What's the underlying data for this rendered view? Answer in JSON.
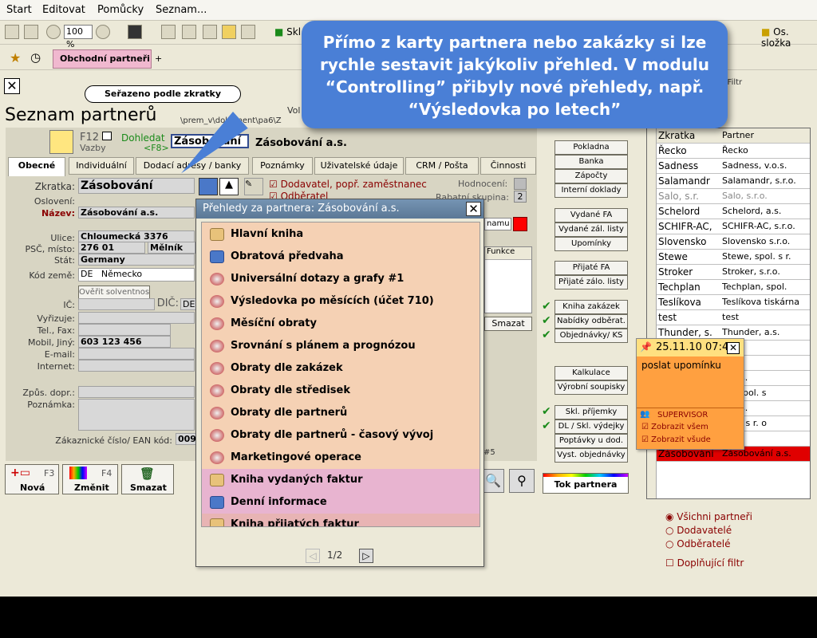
{
  "menu": [
    "Start",
    "Editovat",
    "Pomůcky",
    "Seznam..."
  ],
  "toolbar": {
    "zoom": "100 %",
    "skl": "Skl",
    "os_slozka": "Os. složka"
  },
  "tabbar": {
    "active_tab": "Obchodní partneři",
    "add": "+"
  },
  "sort_bubble": "Seřazeno podle zkratky",
  "page_title": "Seznam partnerů",
  "path": "\\prem_v\\dokument\\pa6\\Z",
  "vol": "Vol",
  "filtr": "/ Filtr",
  "f12": {
    "key": "F12",
    "label": "Vazby"
  },
  "dohledat": {
    "label": "Dohledat",
    "key": "<F8>",
    "value": "Zásobování",
    "result": "Zásobování a.s."
  },
  "tabs": [
    "Obecné",
    "Individuální",
    "Dodací adresy / banky",
    "Poznámky",
    "Uživatelské údaje",
    "CRM / Pošta",
    "Činnosti"
  ],
  "form": {
    "zkratka_label": "Zkratka:",
    "zkratka": "Zásobování",
    "osloveni_label": "Oslovení:",
    "nazev_label": "Název:",
    "nazev": "Zásobování a.s.",
    "ulice_label": "Ulice:",
    "ulice": "Chloumecká 3376",
    "psc_label": "PSČ, místo:",
    "psc": "276 01",
    "misto": "Mělník",
    "stat_label": "Stát:",
    "stat": "Germany",
    "kod_zeme_label": "Kód země:",
    "kod_zeme": "DE",
    "kod_zeme_name": "Německo",
    "overit": "Ověřit solventnost",
    "ic_label": "IČ:",
    "dic_label": "DIČ:",
    "dic": "DE",
    "vyrizuje_label": "Vyřizuje:",
    "tel_label": "Tel., Fax:",
    "mobil_label": "Mobil, Jiný:",
    "mobil": "603 123 456",
    "email_label": "E-mail:",
    "internet_label": "Internet:",
    "zpus_label": "Způs. dopr.:",
    "poznamka_label": "Poznámka:",
    "ean_label": "Zákaznické číslo/ EAN kód:",
    "ean": "009",
    "dodavatel": "Dodavatel, popř. zaměstnanec",
    "odberatel": "Odběratel",
    "hodnoceni_label": "Hodnocení:",
    "rabat_label": "Rabatní skupina:",
    "rabat": "2",
    "namu": "namu",
    "funkce": "Funkce",
    "smazat": "Smazat",
    "page5": "#5"
  },
  "side_buttons": [
    "Pokladna",
    "Banka",
    "Zápočty",
    "Interní doklady",
    "Vydané FA",
    "Vydané zál. listy",
    "Upomínky",
    "Přijaté FA",
    "Přijaté zálo. listy",
    "Kniha zakázek",
    "Nabídky odběrat.",
    "Objednávky/ KS",
    "Kalkulace",
    "Výrobní soupisky",
    "Skl. příjemky",
    "DL / Skl. výdejky",
    "Poptávky u dod.",
    "Vyst. objednávky",
    "Tok partnera"
  ],
  "bottom_buttons": {
    "nova": "Nová",
    "nova_key": "F3",
    "zmenit": "Změnit",
    "zmenit_key": "F4",
    "smazat": "Smazat"
  },
  "right_list": {
    "headers": [
      "Zkratka",
      "Partner"
    ],
    "rows": [
      [
        "Řecko",
        "Řecko"
      ],
      [
        "Sadness",
        "Sadness, v.o.s."
      ],
      [
        "Salamandr",
        "Salamandr, s.r.o."
      ],
      [
        "Salo, s.r.",
        "Salo, s.r.o."
      ],
      [
        "Schelord",
        "Schelord, a.s."
      ],
      [
        "SCHIFR-AC,",
        "SCHIFR-AC, s.r.o."
      ],
      [
        "Slovensko",
        "Slovensko s.r.o."
      ],
      [
        "Stewe",
        "Stewe, spol. s r."
      ],
      [
        "Stroker",
        "Stroker, s.r.o."
      ],
      [
        "Techplan",
        "Techplan, spol."
      ],
      [
        "Teslíkova",
        "Teslíkova tiskárna"
      ],
      [
        "test",
        "test"
      ],
      [
        "Thunder, s.",
        "Thunder, a.s."
      ],
      [
        "",
        "s.r.o."
      ],
      [
        "",
        "s.r.o."
      ],
      [
        "",
        "s, a.s."
      ],
      [
        "",
        "av, spol. s"
      ],
      [
        "",
        "s, a.s."
      ],
      [
        "",
        "spol. s r. o"
      ],
      [
        "",
        "ník"
      ],
      [
        "Zásobování",
        "Zásobování a.s."
      ]
    ]
  },
  "filter_radios": [
    "Všichni partneři",
    "Dodavatelé",
    "Odběratelé"
  ],
  "filter_checkbox": "Doplňující filtr",
  "popup": {
    "title": "Přehledy za partnera: Zásobování a.s.",
    "items": [
      {
        "label": "Hlavní kniha",
        "icon": "book-icon"
      },
      {
        "label": "Obratová předvaha",
        "icon": "calendar-icon"
      },
      {
        "label": "Universální dotazy a grafy #1",
        "icon": "globe-icon"
      },
      {
        "label": "Výsledovka po měsících (účet 710)",
        "icon": "globe-icon"
      },
      {
        "label": "Měsíční obraty",
        "icon": "globe-icon"
      },
      {
        "label": "Srovnání s plánem a prognózou",
        "icon": "globe-icon"
      },
      {
        "label": "Obraty dle zakázek",
        "icon": "globe-icon"
      },
      {
        "label": "Obraty dle středisek",
        "icon": "globe-icon"
      },
      {
        "label": "Obraty dle partnerů",
        "icon": "globe-icon"
      },
      {
        "label": "Obraty dle partnerů - časový vývoj",
        "icon": "globe-icon"
      },
      {
        "label": "Marketingové operace",
        "icon": "globe-icon"
      },
      {
        "label": "Kniha vydaných faktur",
        "icon": "book-icon"
      },
      {
        "label": "Denní informace",
        "icon": "calendar-icon"
      },
      {
        "label": "Kniha přijatých faktur",
        "icon": "book-icon"
      }
    ],
    "page": "1/2"
  },
  "callout": "Přímo z karty partnera nebo zakázky si lze rychle sestavit jakýkoliv přehled. V modulu “Controlling” přibyly nové přehledy, např. “Výsledovka po letech”",
  "note": {
    "date": "25.11.10 07:4",
    "text": "poslat upomínku",
    "user": "SUPERVISOR",
    "check1": "Zobrazit všem",
    "check2": "Zobrazit všude"
  },
  "colors": {
    "callout": "#4a7fd6",
    "popup_peach": "#f5d1b4",
    "popup_pink": "#e8b4d0",
    "tab_active": "#f0b8cf",
    "note": "#ffa040",
    "selected_row": "#e00000"
  }
}
